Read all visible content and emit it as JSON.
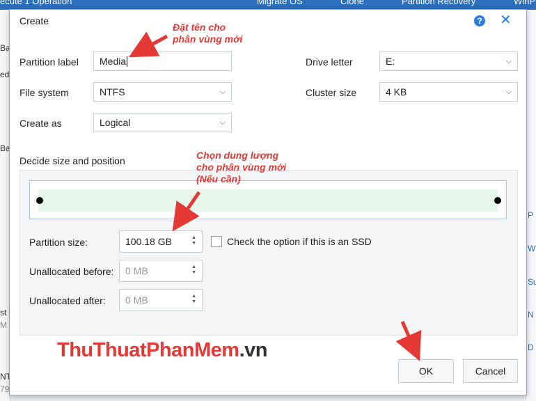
{
  "background": {
    "toolbar": [
      "ecute 1 Operation",
      "Migrate OS",
      "Clone",
      "Partition Recovery",
      "WinP"
    ],
    "left_fragments": [
      "Ba",
      "ed",
      "Ba",
      "st",
      "M",
      "NT",
      "79"
    ],
    "right_fragments": [
      "P",
      "W",
      "Su",
      "N",
      "D"
    ]
  },
  "dialog": {
    "title": "Create",
    "help_icon": "?",
    "close_icon": "✕",
    "partition_label": {
      "label": "Partition label",
      "value": "Media"
    },
    "file_system": {
      "label": "File system",
      "value": "NTFS"
    },
    "create_as": {
      "label": "Create as",
      "value": "Logical"
    },
    "drive_letter": {
      "label": "Drive letter",
      "value": "E:"
    },
    "cluster_size": {
      "label": "Cluster size",
      "value": "4 KB"
    },
    "size_section": {
      "heading": "Decide size and position",
      "partition_size": {
        "label": "Partition size:",
        "value": "100.18 GB"
      },
      "unallocated_before": {
        "label": "Unallocated before:",
        "value": "0 MB"
      },
      "unallocated_after": {
        "label": "Unallocated after:",
        "value": "0 MB"
      },
      "ssd_option": {
        "label": "Check the option if this is an SSD",
        "checked": false
      }
    },
    "buttons": {
      "ok": "OK",
      "cancel": "Cancel"
    }
  },
  "annotations": {
    "name_note": [
      "Đặt tên cho",
      "phân vùng mới"
    ],
    "size_note": [
      "Chọn dung lượng",
      "cho phân vùng mới",
      "(Nếu cần)"
    ],
    "color": "#e53935"
  },
  "watermark": {
    "part1": "ThuThuat",
    "part2": "PhanMem",
    "part3": ".vn"
  },
  "colors": {
    "accent": "#2b7de0",
    "toolbar": "#2c6fbf",
    "slider_fill": "#e6f6ea",
    "slider_border": "#a9c6ea"
  }
}
